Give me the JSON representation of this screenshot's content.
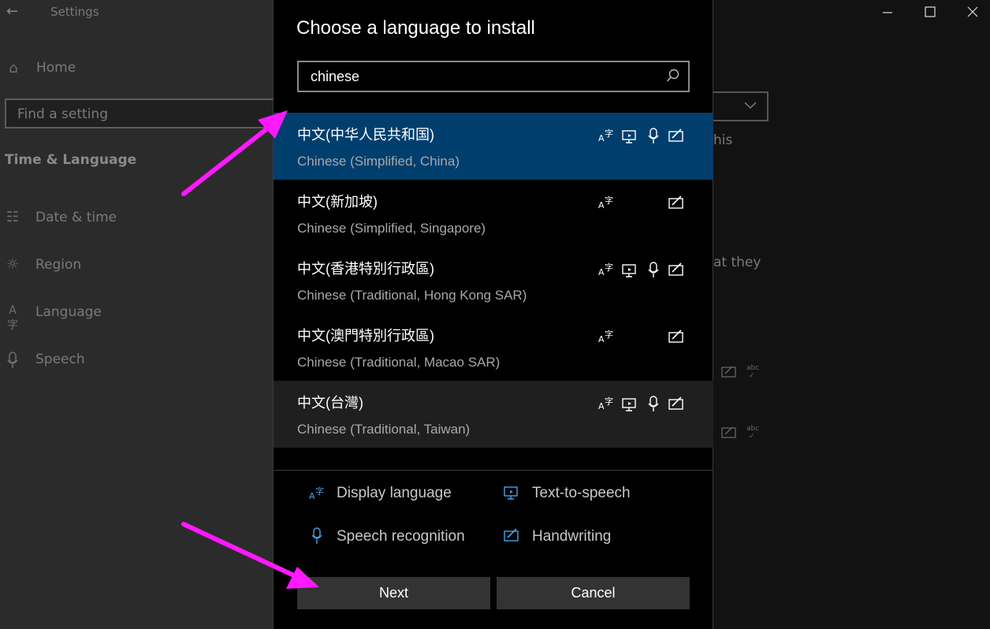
{
  "window": {
    "title": "Settings",
    "controls": [
      "minimize",
      "maximize",
      "close"
    ]
  },
  "sidebar": {
    "home": "Home",
    "search_placeholder": "Find a setting",
    "section": "Time & Language",
    "items": [
      {
        "label": "Date & time",
        "icon": "calendar-clock-icon"
      },
      {
        "label": "Region",
        "icon": "globe-icon"
      },
      {
        "label": "Language",
        "icon": "language-icon"
      },
      {
        "label": "Speech",
        "icon": "microphone-icon"
      }
    ]
  },
  "background_fragments": {
    "text1": "his",
    "text2": "at they"
  },
  "dialog": {
    "title": "Choose a language to install",
    "search_value": "chinese",
    "languages": [
      {
        "native": "中文(中华人民共和国)",
        "english": "Chinese (Simplified, China)",
        "features": [
          "display-language",
          "text-to-speech",
          "speech-recognition",
          "handwriting"
        ],
        "state": "selected"
      },
      {
        "native": "中文(新加坡)",
        "english": "Chinese (Simplified, Singapore)",
        "features": [
          "display-language",
          "handwriting"
        ],
        "state": "normal"
      },
      {
        "native": "中文(香港特別行政區)",
        "english": "Chinese (Traditional, Hong Kong SAR)",
        "features": [
          "display-language",
          "text-to-speech",
          "speech-recognition",
          "handwriting"
        ],
        "state": "normal"
      },
      {
        "native": "中文(澳門特別行政區)",
        "english": "Chinese (Traditional, Macao SAR)",
        "features": [
          "display-language",
          "handwriting"
        ],
        "state": "normal"
      },
      {
        "native": "中文(台灣)",
        "english": "Chinese (Traditional, Taiwan)",
        "features": [
          "display-language",
          "text-to-speech",
          "speech-recognition",
          "handwriting"
        ],
        "state": "hover"
      }
    ],
    "legend": {
      "display_language": "Display language",
      "text_to_speech": "Text-to-speech",
      "speech_recognition": "Speech recognition",
      "handwriting": "Handwriting"
    },
    "buttons": {
      "next": "Next",
      "cancel": "Cancel"
    }
  },
  "colors": {
    "selected_row": "#003e6e",
    "hover_row": "#1f1f1f",
    "accent_icon": "#4aa3e6",
    "annotation_arrow": "#ff19ff",
    "button_bg": "#333333"
  }
}
